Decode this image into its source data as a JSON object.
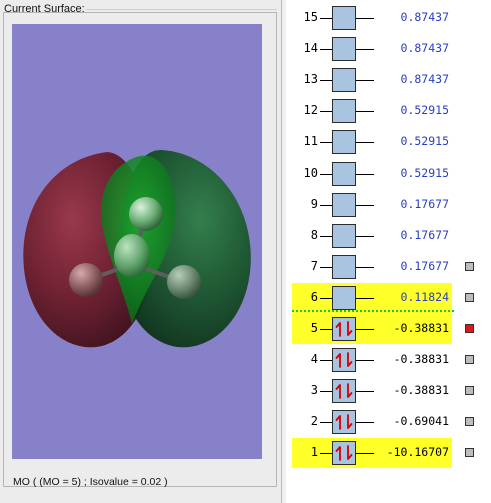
{
  "surface_panel": {
    "title": "Current Surface:",
    "status": "MO ( (MO = 5) ; Isovalue = 0.02 )"
  },
  "colors": {
    "background": "#8681c9",
    "lobe_negative": "#7a1f2f",
    "lobe_positive": "#1b5a2b",
    "highlight": "#ffff2a",
    "orbital_box": "#a8c4e0",
    "selected_marker": "#e11717",
    "homo_lumo_divider": "#19c719"
  },
  "orbitals": [
    {
      "index": "15",
      "energy": "0.87437",
      "occupied": false,
      "highlighted": false,
      "selected": false,
      "marker": false
    },
    {
      "index": "14",
      "energy": "0.87437",
      "occupied": false,
      "highlighted": false,
      "selected": false,
      "marker": false
    },
    {
      "index": "13",
      "energy": "0.87437",
      "occupied": false,
      "highlighted": false,
      "selected": false,
      "marker": false
    },
    {
      "index": "12",
      "energy": "0.52915",
      "occupied": false,
      "highlighted": false,
      "selected": false,
      "marker": false
    },
    {
      "index": "11",
      "energy": "0.52915",
      "occupied": false,
      "highlighted": false,
      "selected": false,
      "marker": false
    },
    {
      "index": "10",
      "energy": "0.52915",
      "occupied": false,
      "highlighted": false,
      "selected": false,
      "marker": false
    },
    {
      "index": "9",
      "energy": "0.17677",
      "occupied": false,
      "highlighted": false,
      "selected": false,
      "marker": false
    },
    {
      "index": "8",
      "energy": "0.17677",
      "occupied": false,
      "highlighted": false,
      "selected": false,
      "marker": false
    },
    {
      "index": "7",
      "energy": "0.17677",
      "occupied": false,
      "highlighted": false,
      "selected": false,
      "marker": true
    },
    {
      "index": "6",
      "energy": "0.11824",
      "occupied": false,
      "highlighted": true,
      "selected": false,
      "marker": true
    },
    {
      "index": "5",
      "energy": "-0.38831",
      "occupied": true,
      "highlighted": true,
      "selected": true,
      "marker": true
    },
    {
      "index": "4",
      "energy": "-0.38831",
      "occupied": true,
      "highlighted": false,
      "selected": false,
      "marker": true
    },
    {
      "index": "3",
      "energy": "-0.38831",
      "occupied": true,
      "highlighted": false,
      "selected": false,
      "marker": true
    },
    {
      "index": "2",
      "energy": "-0.69041",
      "occupied": true,
      "highlighted": false,
      "selected": false,
      "marker": true
    },
    {
      "index": "1",
      "energy": "-10.16707",
      "occupied": true,
      "highlighted": true,
      "selected": false,
      "marker": true
    }
  ]
}
